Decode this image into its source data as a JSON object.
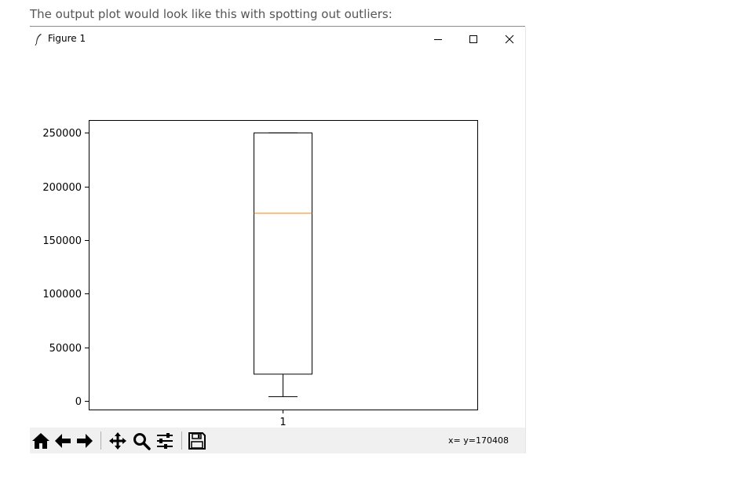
{
  "caption": "The output plot would look like this with spotting out outliers:",
  "window": {
    "title": "Figure 1",
    "icons": [
      "feather-icon",
      "minimize-icon",
      "maximize-icon",
      "close-icon"
    ]
  },
  "toolbar": {
    "buttons": [
      "home-icon",
      "back-arrow-icon",
      "forward-arrow-icon",
      "pan-icon",
      "zoom-icon",
      "configure-subplots-icon",
      "save-icon"
    ],
    "coordinate_readout": "x= y=170408"
  },
  "chart_data": {
    "type": "box",
    "title": "",
    "xlabel": "",
    "ylabel": "",
    "categories": [
      "1"
    ],
    "boxes": [
      {
        "label": "1",
        "whisker_low": 4000,
        "q1": 25000,
        "median": 175000,
        "q3": 250000,
        "whisker_high": 250000,
        "outliers": []
      }
    ],
    "ylim": [
      -8000,
      262000
    ],
    "yticks": [
      0,
      50000,
      100000,
      150000,
      200000,
      250000
    ],
    "ytick_labels": [
      "0",
      "50000",
      "100000",
      "150000",
      "200000",
      "250000"
    ],
    "grid": false,
    "colors": {
      "box": "#000000",
      "median": "#ff7f0e"
    }
  }
}
